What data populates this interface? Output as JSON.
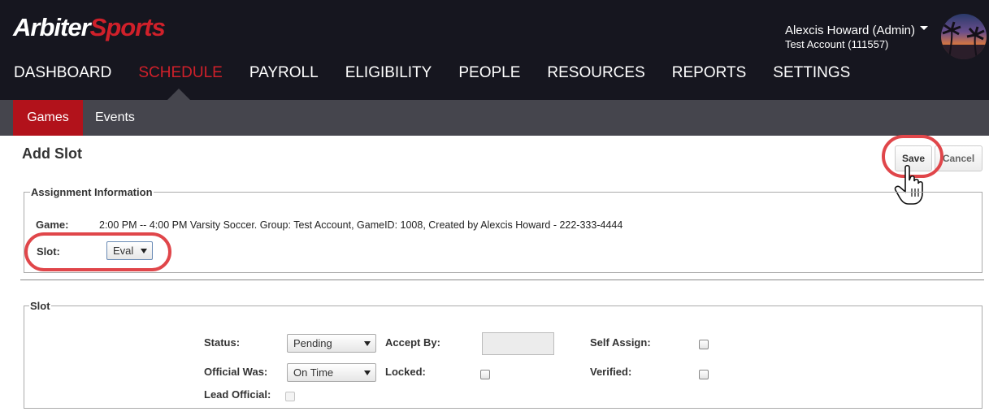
{
  "brand": {
    "part1": "Arbiter",
    "part2": "Sports",
    "color_brand_red": "#d0202a"
  },
  "user": {
    "name": "Alexcis Howard (Admin)",
    "account": "Test Account (111557)"
  },
  "main_nav": [
    {
      "label": "DASHBOARD"
    },
    {
      "label": "SCHEDULE",
      "active": true
    },
    {
      "label": "PAYROLL"
    },
    {
      "label": "ELIGIBILITY"
    },
    {
      "label": "PEOPLE"
    },
    {
      "label": "RESOURCES"
    },
    {
      "label": "REPORTS"
    },
    {
      "label": "SETTINGS"
    }
  ],
  "sub_nav": [
    {
      "label": "Games",
      "active": true
    },
    {
      "label": "Events"
    }
  ],
  "page": {
    "title": "Add Slot",
    "save_label": "Save",
    "cancel_label": "Cancel"
  },
  "assignment": {
    "legend": "Assignment Information",
    "game_label": "Game:",
    "game_value": "2:00 PM -- 4:00 PM Varsity Soccer. Group: Test Account, GameID: 1008, Created by Alexcis Howard - 222-333-4444",
    "slot_label": "Slot:",
    "slot_value": "Eval"
  },
  "slot": {
    "legend": "Slot",
    "status_label": "Status:",
    "status_value": "Pending",
    "accept_by_label": "Accept By:",
    "accept_by_value": "",
    "self_assign_label": "Self Assign:",
    "self_assign_checked": false,
    "official_was_label": "Official Was:",
    "official_was_value": "On Time",
    "locked_label": "Locked:",
    "locked_checked": false,
    "verified_label": "Verified:",
    "verified_checked": false,
    "lead_official_label": "Lead Official:",
    "lead_official_checked": false
  },
  "annotation_color": "#e0464a",
  "icons": {
    "user_menu_caret": "caret-down-icon",
    "pointer_cursor": "hand-cursor-icon"
  }
}
